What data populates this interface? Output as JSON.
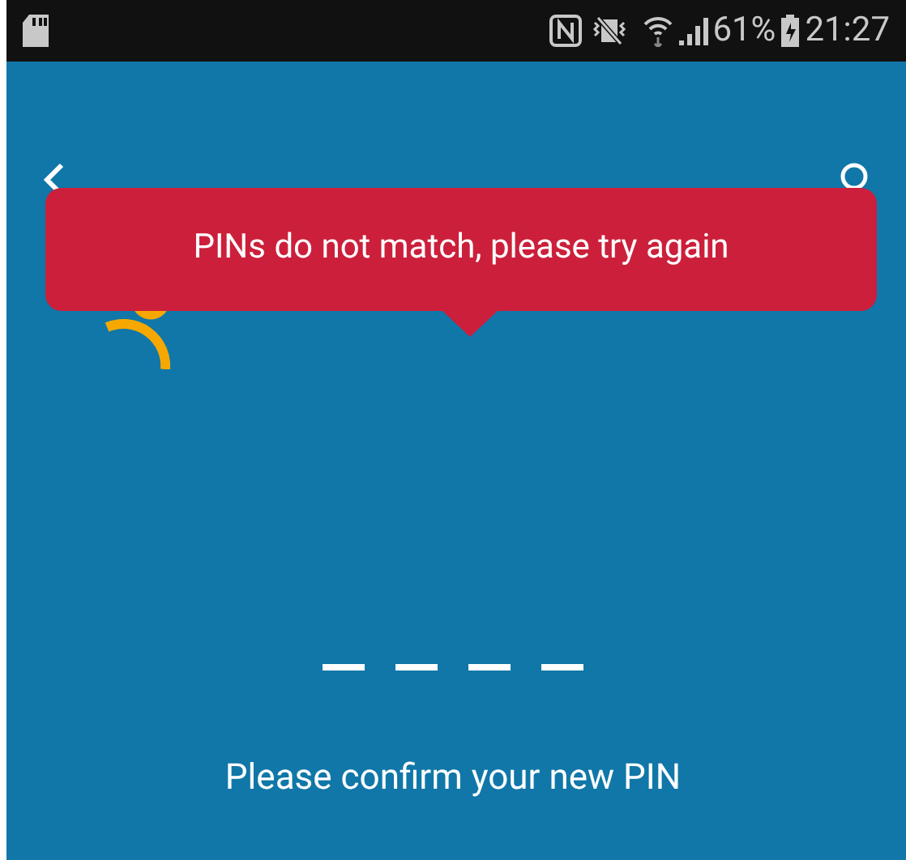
{
  "status_bar": {
    "battery_percent": "61%",
    "time": "21:27"
  },
  "tooltip": {
    "message": "PINs do not match, please try again"
  },
  "pin_slots": [
    {
      "filled": false
    },
    {
      "filled": false
    },
    {
      "filled": false
    },
    {
      "filled": false
    }
  ],
  "prompt": "Please confirm your new PIN"
}
